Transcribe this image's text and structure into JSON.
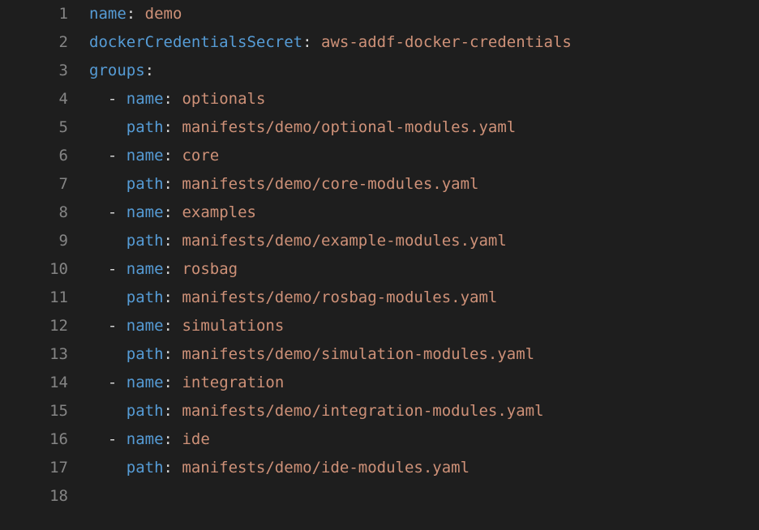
{
  "lineNumbers": [
    "1",
    "2",
    "3",
    "4",
    "5",
    "6",
    "7",
    "8",
    "9",
    "10",
    "11",
    "12",
    "13",
    "14",
    "15",
    "16",
    "17",
    "18"
  ],
  "code": {
    "l1": {
      "key": "name",
      "val": "demo"
    },
    "l2": {
      "key": "dockerCredentialsSecret",
      "val": "aws-addf-docker-credentials"
    },
    "l3": {
      "key": "groups"
    },
    "l4": {
      "key": "name",
      "val": "optionals"
    },
    "l5": {
      "key": "path",
      "val": "manifests/demo/optional-modules.yaml"
    },
    "l6": {
      "key": "name",
      "val": "core"
    },
    "l7": {
      "key": "path",
      "val": "manifests/demo/core-modules.yaml"
    },
    "l8": {
      "key": "name",
      "val": "examples"
    },
    "l9": {
      "key": "path",
      "val": "manifests/demo/example-modules.yaml"
    },
    "l10": {
      "key": "name",
      "val": "rosbag"
    },
    "l11": {
      "key": "path",
      "val": "manifests/demo/rosbag-modules.yaml"
    },
    "l12": {
      "key": "name",
      "val": "simulations"
    },
    "l13": {
      "key": "path",
      "val": "manifests/demo/simulation-modules.yaml"
    },
    "l14": {
      "key": "name",
      "val": "integration"
    },
    "l15": {
      "key": "path",
      "val": "manifests/demo/integration-modules.yaml"
    },
    "l16": {
      "key": "name",
      "val": "ide"
    },
    "l17": {
      "key": "path",
      "val": "manifests/demo/ide-modules.yaml"
    }
  },
  "glyphs": {
    "colon": ":",
    "dash": "-",
    "indent": "  ",
    "guide": " "
  }
}
